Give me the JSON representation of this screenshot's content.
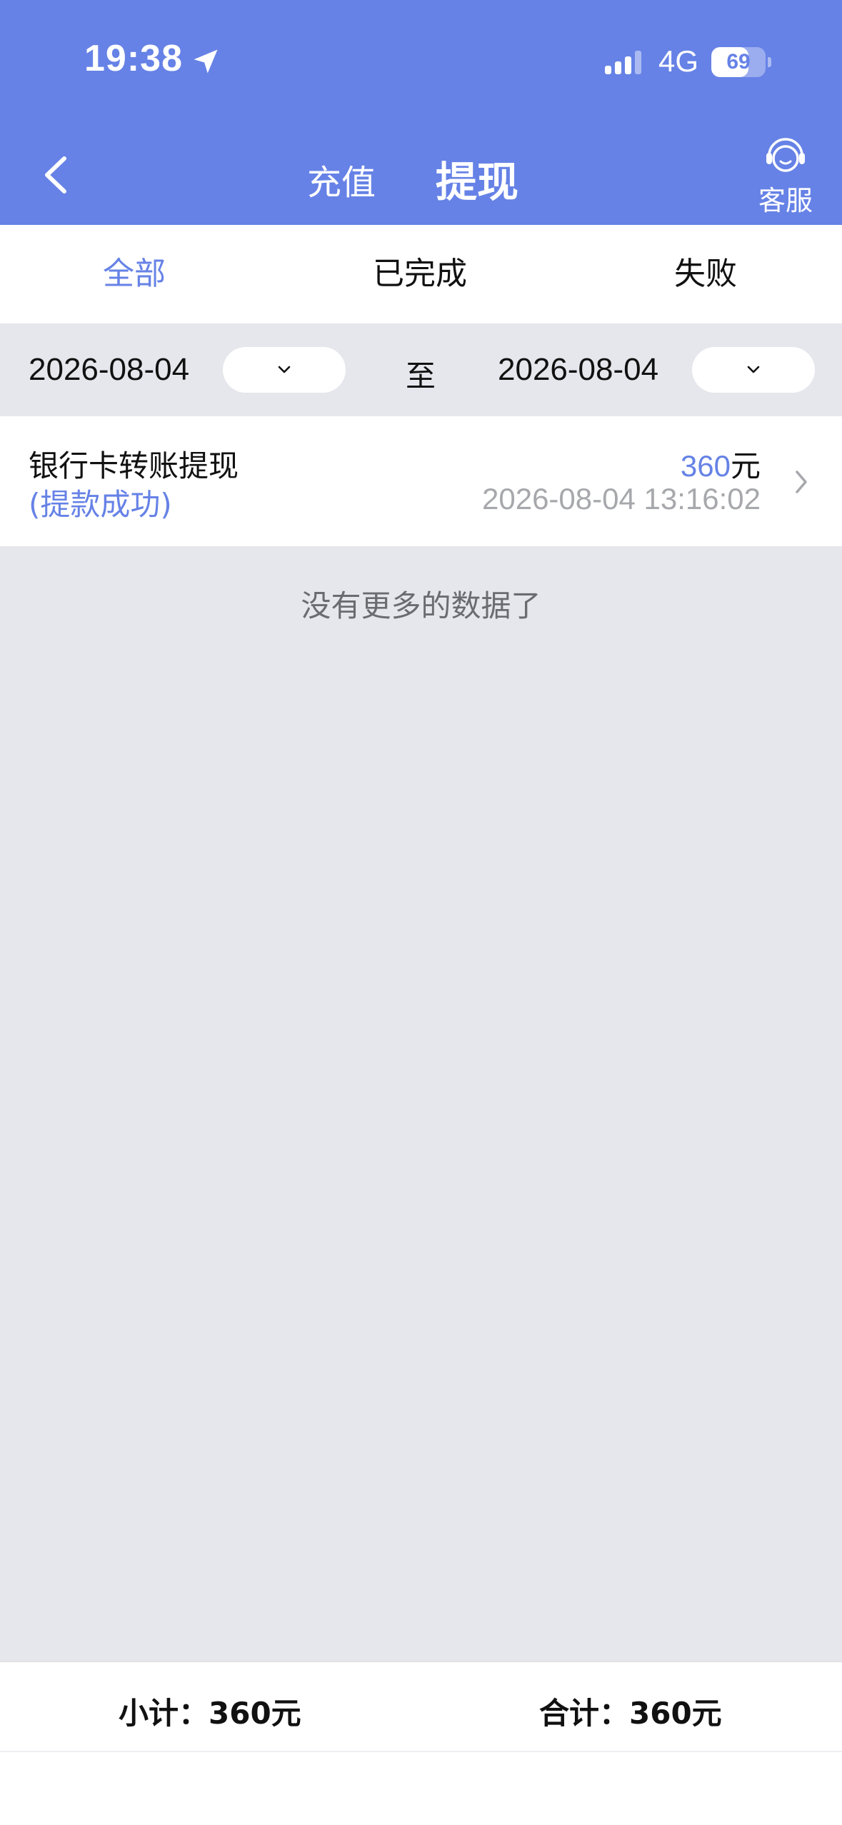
{
  "status_bar": {
    "time": "19:38",
    "network": "4G",
    "battery": "69",
    "battery_level": 0.69
  },
  "nav": {
    "tab_recharge": "充值",
    "tab_withdraw": "提现",
    "service_label": "客服"
  },
  "filter_tabs": [
    {
      "label": "全部",
      "active": true
    },
    {
      "label": "已完成",
      "active": false
    },
    {
      "label": "失败",
      "active": false
    }
  ],
  "date_range": {
    "start": "2026-08-04",
    "separator": "至",
    "end": "2026-08-04"
  },
  "records": [
    {
      "title": "银行卡转账提现",
      "status": "(提款成功)",
      "amount": "360",
      "unit": "元",
      "time": "2026-08-04 13:16:02"
    }
  ],
  "list_end_text": "没有更多的数据了",
  "summary": {
    "subtotal": "小计：360元",
    "total": "合计：360元"
  },
  "colors": {
    "accent": "#6682e6",
    "background": "#e6e7ec"
  }
}
